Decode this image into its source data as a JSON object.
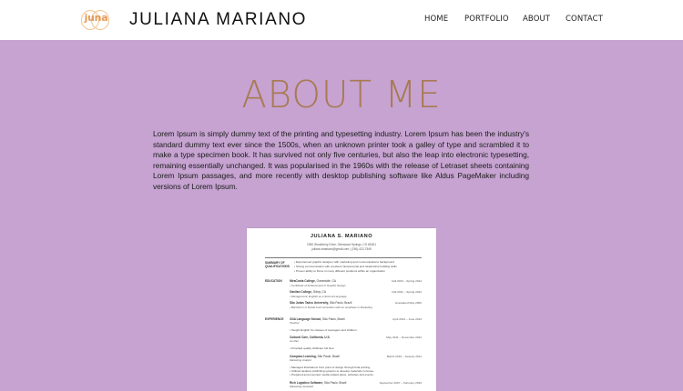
{
  "header": {
    "logo_text": "juna",
    "site_title": "JULIANA MARIANO",
    "nav": [
      "HOME",
      "PORTFOLIO",
      "ABOUT",
      "CONTACT"
    ]
  },
  "about": {
    "heading": "ABOUT ME",
    "paragraph": "Lorem Ipsum is simply dummy text of the printing and typesetting industry. Lorem Ipsum has been the industry's standard dummy text ever since the 1500s, when an unknown printer took a galley of type and scrambled it to make a type specimen book. It has survived not only five centuries, but also the leap into electronic typesetting, remaining essentially unchanged. It was popularised in the 1960s with the release of Letraset sheets containing Lorem Ipsum passages, and more recently with desktop publishing software like Aldus PageMaker including versions of Lorem Ipsum."
  },
  "resume": {
    "name": "JULIANA S. MARIANO",
    "address": "2350 Woodberry Drive, Glenwood Springs, CO 81601",
    "contact": "juliana.smariano@gmail.com | (760)-422-7549",
    "sections": {
      "summary": "SUMMARY OF QUALIFICATIONS",
      "education": "EDUCATION",
      "experience": "EXPERIENCE"
    },
    "summary_items": [
      "• Experienced graphic designer with marketing and communications background",
      "• Strong communication with excellent interpersonal and relationship building skills",
      "• Proven ability to thrive in many different positions within an organization"
    ],
    "education": [
      {
        "org": "MiraCosta College,",
        "loc": "Oceanside, CA",
        "date": "Fall 2013 – Spring 2014",
        "detail": "• Certificate of Achievement in Graphic Design"
      },
      {
        "org": "Gavilan College,",
        "loc": "Gilroy, CA",
        "date": "Fall 2011 – Spring 2012",
        "detail": "• Management; English as a Second Language"
      },
      {
        "org": "São Judas Tadeu University,",
        "loc": "São Paulo, Brazil",
        "date": "Graduated May 2006",
        "detail": "• Bachelor's in Social Communication with an emphasis in Marketing"
      }
    ],
    "experience": [
      {
        "org": "CNA Language School,",
        "loc": "São Paulo, Brazil",
        "date": "April 2013 – June 2013",
        "role": "Teacher",
        "details": [
          "• Taught English for classes of teenagers and children."
        ]
      },
      {
        "org": "Cultural Care, California, U.S.",
        "loc": "",
        "date": "May 2011 – November 2012",
        "role": "Au Pair",
        "details": [
          "• Provided quality childcare full time"
        ]
      },
      {
        "org": "Compass Learning,",
        "loc": "São Paulo, Brazil",
        "date": "March 2010 – January 2011",
        "role": "Marketing Analyst",
        "details": [
          "• Managed illustrations from point of design through final printing.",
          "• Utilized desktop publishing systems to develop materials in-house.",
          "• Prepared and executed media-related plans, activities and events."
        ]
      },
      {
        "org": "Rich Logistics Software,",
        "loc": "São Paulo, Brazil",
        "date": "September 2007 – February 2010",
        "role": "Marketing Assistant",
        "details": []
      }
    ]
  }
}
